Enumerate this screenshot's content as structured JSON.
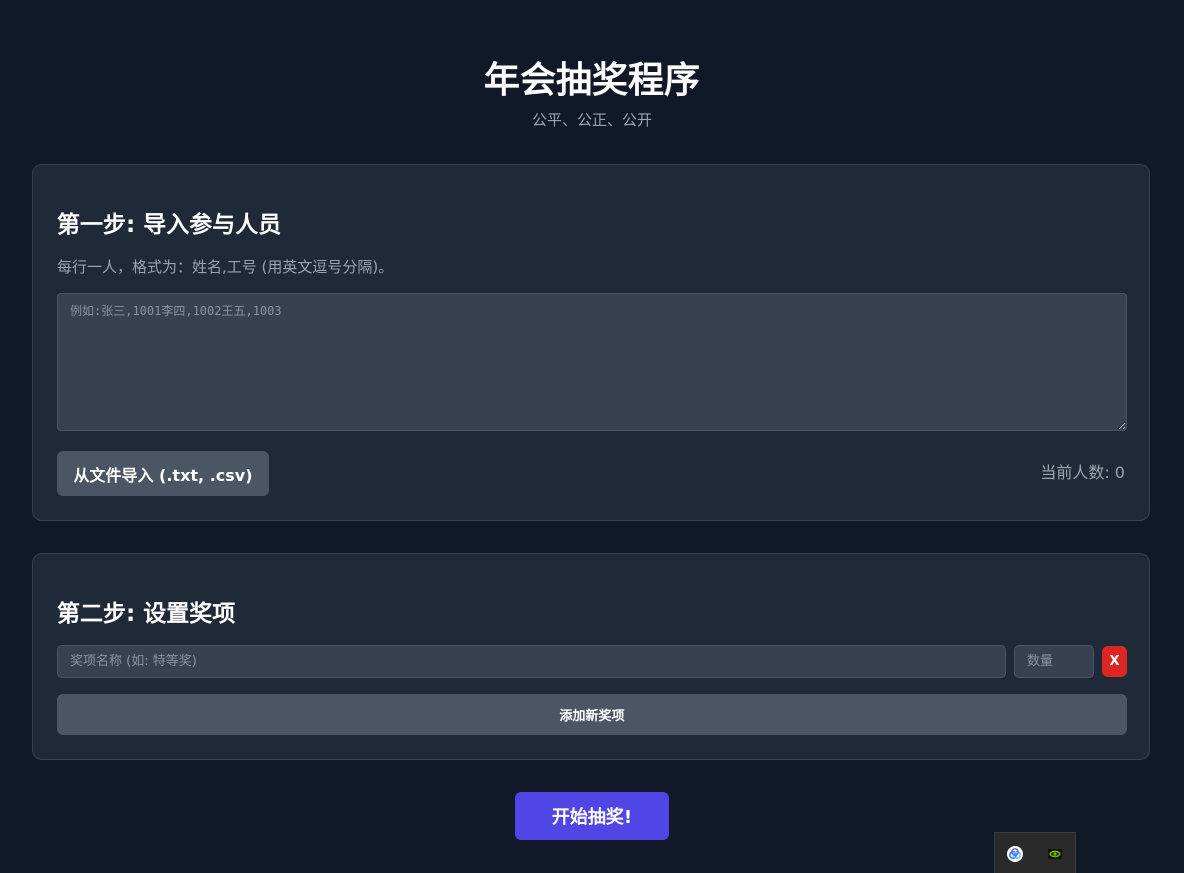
{
  "header": {
    "title": "年会抽奖程序",
    "subtitle": "公平、公正、公开"
  },
  "step1": {
    "title": "第一步: 导入参与人员",
    "hint": "每行一人，格式为：姓名,工号 (用英文逗号分隔)。",
    "textarea_placeholder": "例如:张三,1001李四,1002王五,1003",
    "textarea_value": "",
    "import_label": "从文件导入 (.txt, .csv)",
    "count_label": "当前人数: 0"
  },
  "step2": {
    "title": "第二步: 设置奖项",
    "prize_name_placeholder": "奖项名称 (如: 特等奖)",
    "prize_name_value": "",
    "prize_qty_placeholder": "数量",
    "prize_qty_value": "",
    "remove_label": "X",
    "add_label": "添加新奖项"
  },
  "start_label": "开始抽奖!",
  "tray": {
    "icons": [
      "cloud-sync-icon",
      "nvidia-icon"
    ]
  },
  "colors": {
    "background": "#111827",
    "card": "#1f2937",
    "accent": "#4f46e5",
    "danger": "#dc2626",
    "secondary_button": "#4b5563"
  }
}
